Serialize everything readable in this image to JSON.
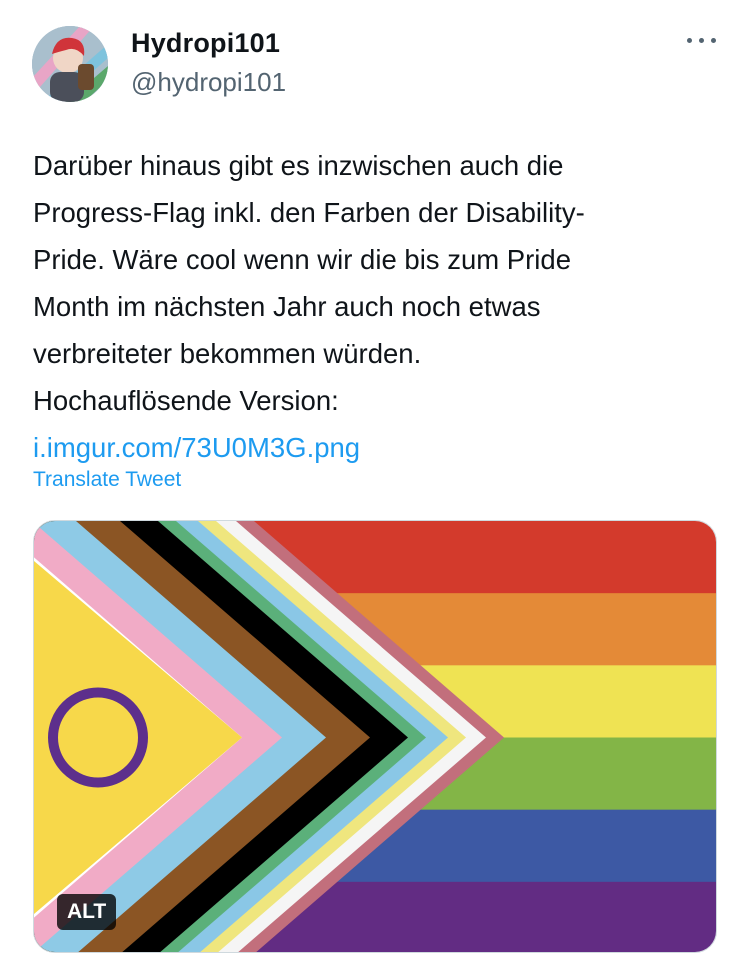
{
  "tweet": {
    "author": {
      "display_name": "Hydropi101",
      "handle": "@hydropi101"
    },
    "body_lines": [
      "Darüber hinaus gibt es inzwischen auch die",
      "Progress-Flag inkl. den Farben der Disability-",
      "Pride. Wäre cool wenn wir die bis zum Pride",
      "Month im nächsten Jahr auch noch etwas",
      "verbreiteter bekommen würden.",
      "Hochauflösende Version:"
    ],
    "link_text": "i.imgur.com/73U0M3G.png",
    "translate_label": "Translate Tweet",
    "media": {
      "alt_badge": "ALT",
      "flag": {
        "stripe_colors": [
          "#d33a2c",
          "#e48a37",
          "#efe353",
          "#83b547",
          "#3d59a4",
          "#622c83"
        ],
        "chevron_colors": [
          "#c26f7c",
          "#f5f5f5",
          "#efe67e",
          "#8ac7e6",
          "#5bb07a",
          "#000000",
          "#8b5524",
          "#8ecae6",
          "#f1abc6",
          "#ffffff"
        ],
        "intersex_field": "#f7d84a",
        "intersex_ring": "#5d2f8c"
      }
    }
  },
  "icons": {
    "more": "more-horizontal-icon"
  }
}
